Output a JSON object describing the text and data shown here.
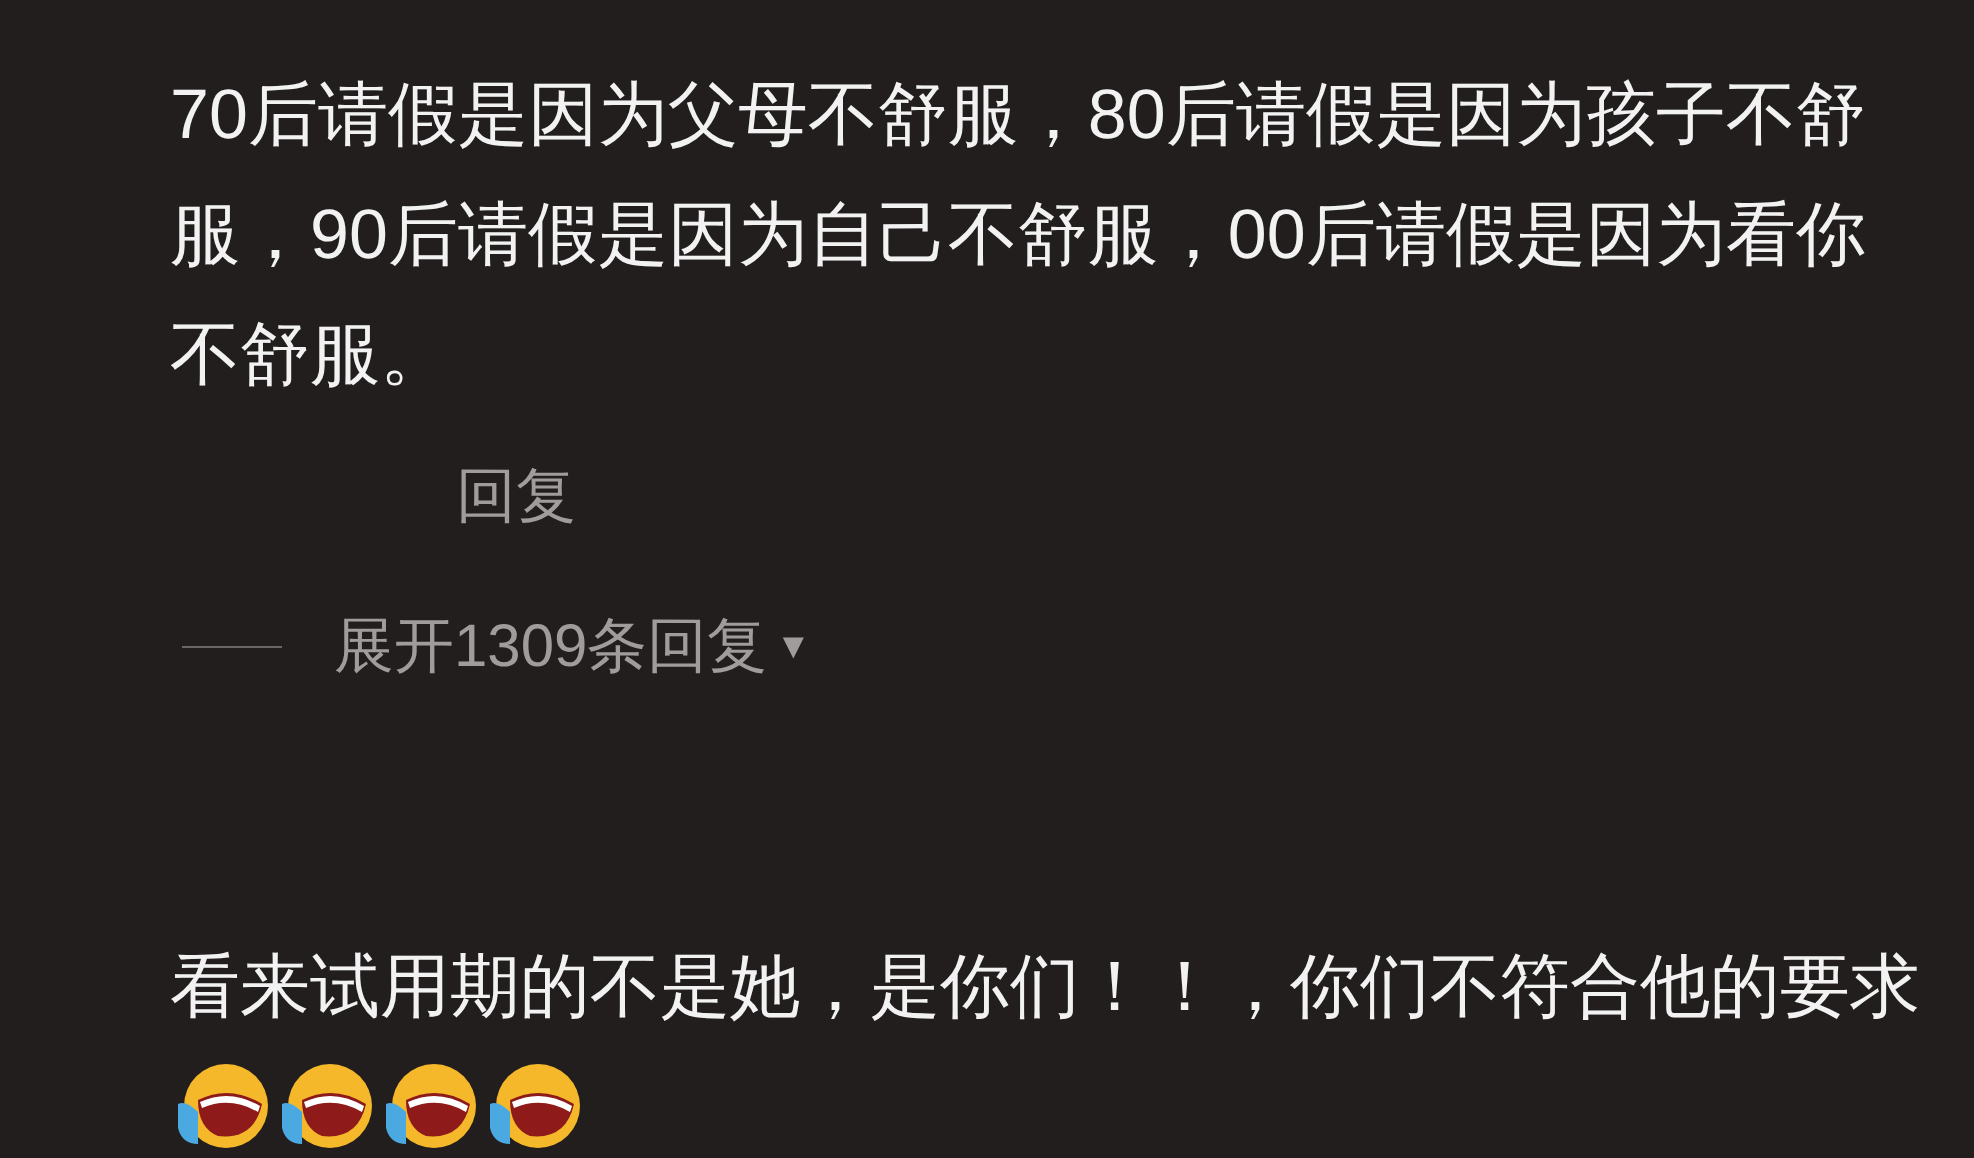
{
  "comments": [
    {
      "text": "70后请假是因为父母不舒服，80后请假是因为孩子不舒服，90后请假是因为自己不舒服，00后请假是因为看你不舒服。",
      "reply_button": "回复",
      "expand_replies": {
        "label": "展开1309条回复",
        "caret": "▼"
      }
    },
    {
      "text": "看来试用期的不是她，是你们！！，你们不符合他的要求",
      "emojis": [
        {
          "kind": "laughing"
        },
        {
          "kind": "laughing"
        },
        {
          "kind": "laughing"
        },
        {
          "kind": "laughing"
        }
      ]
    }
  ]
}
